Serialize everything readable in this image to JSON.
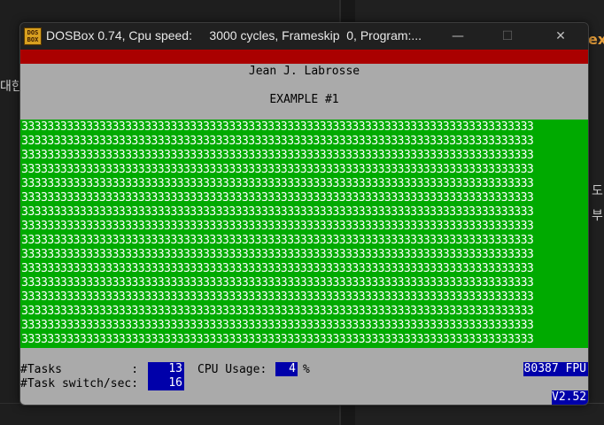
{
  "background": {
    "left_text_1": "대한",
    "right_text_ex": "ex",
    "right_text_2": "도",
    "right_text_3": "부"
  },
  "window": {
    "title": "DOSBox 0.74, Cpu speed:     3000 cycles, Frameskip  0, Program:...",
    "icon_text_1": "DOS",
    "icon_text_2": "BOX",
    "minimize_glyph": "—",
    "maximize_glyph": "☐",
    "close_glyph": "✕"
  },
  "screen": {
    "author": "Jean J. Labrosse",
    "example": "EXAMPLE #1",
    "grid_rows": [
      "3333333333333333333333333333333333333333333333333333333333333333333333333333333",
      "3333333333333333333333333333333333333333333333333333333333333333333333333333333",
      "3333333333333333333333333333333333333333333333333333333333333333333333333333333",
      "3333333333333333333333333333333333333333333333333333333333333333333333333333333",
      "3333333333333333333333333333333333333333333333333333333333333333333333333333333",
      "3333333333333333333333333333333333333333333333333333333333333333333333333333333",
      "3333333333333333333333333333333333333333333333333333333333333333333333333333333",
      "3333333333333333333333333333333333333333333333333333333333333333333333333333333",
      "3333333333333333333333333333333333333333333333333333333333333333333333333333333",
      "3333333333333333333333333333333333333333333333333333333333333333333333333333333",
      "3333333333333333333333333333333333333333333333333333333333333333333333333333333",
      "3333333333333333333333333333333333333333333333333333333333333333333333333333333",
      "3333333333333333333333333333333333333333333333333333333333333333333333333333333",
      "3333333333333333333333333333333333333333333333333333333333333333333333333333333",
      "3333333333333333333333333333333333333333333333333333333333333333333333333333333",
      "3333333333333333333333333333333333333333333333333333333333333333333333333333333"
    ],
    "tasks_label": "#Tasks          :",
    "tasks_value": "13",
    "switch_label": "#Task switch/sec:",
    "switch_value": "16",
    "cpu_label": "CPU Usage:",
    "cpu_value": "4",
    "cpu_unit": "%",
    "fpu_text": "80387 FPU",
    "version_text": "V2.52"
  },
  "colors": {
    "dos_gray": "#aaaaaa",
    "dos_red": "#aa0000",
    "dos_green": "#00aa00",
    "dos_blue": "#0000aa"
  }
}
